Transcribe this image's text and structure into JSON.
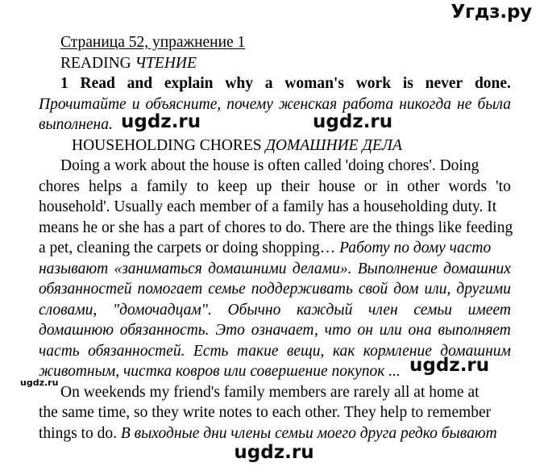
{
  "site": {
    "logo": "Угдз.ру",
    "watermark": "ugdz.ru"
  },
  "document": {
    "heading_page": "Страница 52, упражнение 1",
    "heading_reading_en": "READING ",
    "heading_reading_ru": "ЧТЕНИЕ",
    "task": {
      "number": "1",
      "words": [
        "Read",
        "and",
        "explain",
        "why",
        "a",
        "woman's",
        "work",
        "is",
        "never",
        "done."
      ]
    },
    "task_translation_line1": [
      "Прочитайте",
      "и",
      "объясните,",
      "почему",
      "женская",
      "работа",
      "никогда",
      "не",
      "была"
    ],
    "task_translation_line2": "выполнена.",
    "section_title_en": "HOUSEHOLDING CHORES ",
    "section_title_ru": "ДОМАШНИЕ ДЕЛА",
    "paragraph1": {
      "line1": "Doing a work about the house is often called 'doing chores'. Doing",
      "line2": [
        "chores",
        "helps",
        "a",
        "family",
        "to",
        "keep",
        "up",
        "their",
        "house",
        "or",
        "in",
        "other",
        "words",
        "'to"
      ],
      "line3": "household'. Usually each member of a family has a householding duty. It",
      "line4": "means he or she has a part of chores to do. There are the things like feeding",
      "line5_en": "a pet, cleaning the carpets or doing shopping… ",
      "line5_ru": "Работу по дому часто",
      "line6": [
        "называют",
        "«заниматься",
        "домашними",
        "делами».",
        "Выполнение",
        "домашних"
      ],
      "line7": [
        "обязанностей",
        "помогает",
        "семье",
        "поддерживать",
        "свой",
        "дом",
        "или,",
        "другими"
      ],
      "line8": [
        "словами,",
        "\"домочадцам\".",
        "Обычно",
        "каждый",
        "член",
        "семьи",
        "имеет"
      ],
      "line9": [
        "домашнюю",
        "обязанность.",
        "Это",
        "означает,",
        "что",
        "он",
        "или",
        "она",
        "выполняет"
      ],
      "line10": [
        "часть",
        "обязанностей.",
        "Есть",
        "такие",
        "вещи,",
        "как",
        "кормление",
        "домашним"
      ],
      "line11": "животным, чистка ковров или совершение покупок ..."
    },
    "paragraph2": {
      "line1": "On weekends my friend's family members are rarely all at home at",
      "line2": "the same time, so they write notes to each other. They help to remember",
      "line3_en": "things to do. ",
      "line3_ru": "В выходные дни члены семьи моего друга редко бывают"
    }
  }
}
